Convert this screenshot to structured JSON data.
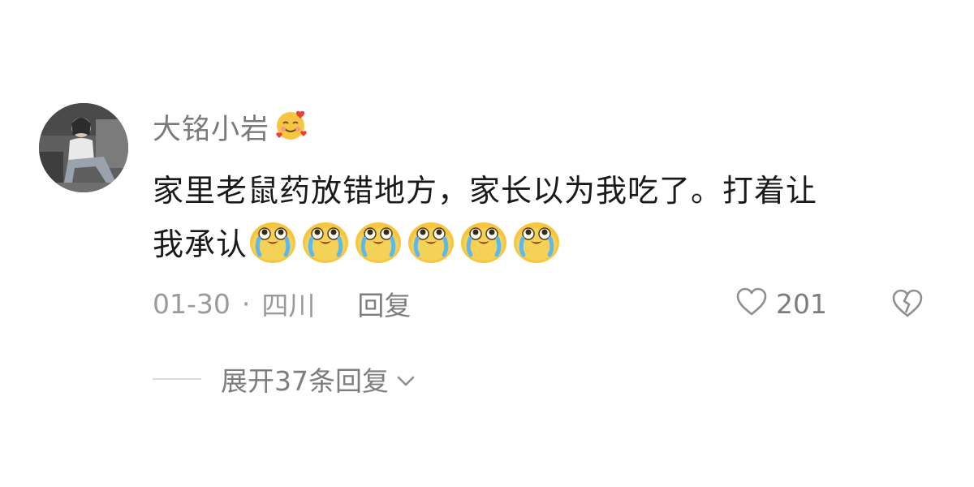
{
  "comment": {
    "username": "大铭小岩",
    "text_line1": "家里老鼠药放错地方，家长以为我吃了。打着让",
    "text_line2": "我承认",
    "emoji_count": 6,
    "date": "01-30",
    "separator": "·",
    "location": "四川",
    "reply_label": "回复",
    "like_count": "201",
    "expand_label": "展开37条回复"
  },
  "icons": {
    "name_emoji": "smiling-face-with-hearts-icon",
    "crying_emoji": "loudly-crying-face-icon",
    "like": "heart-outline-icon",
    "dislike": "broken-heart-icon",
    "expand": "chevron-down-icon"
  },
  "colors": {
    "username": "#7a7a7a",
    "text": "#1a1a1a",
    "meta": "#9a9a9a",
    "emoji_yellow": "#f7c640"
  }
}
